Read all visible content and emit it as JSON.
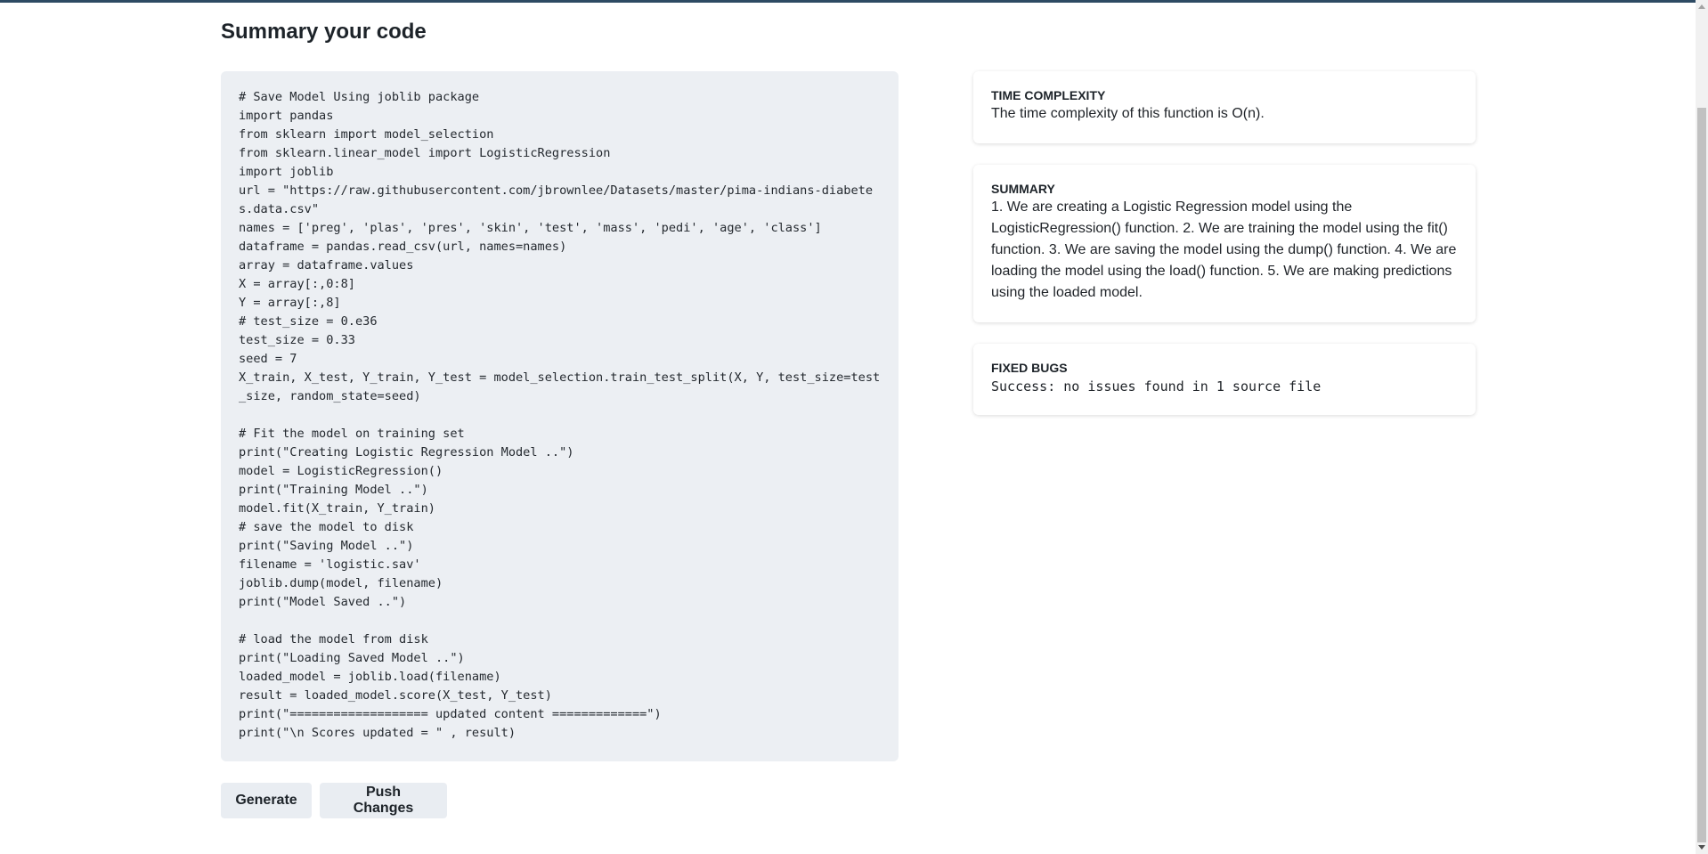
{
  "page": {
    "title": "Summary your code"
  },
  "code": {
    "content": "# Save Model Using joblib package\nimport pandas\nfrom sklearn import model_selection\nfrom sklearn.linear_model import LogisticRegression\nimport joblib\nurl = \"https://raw.githubusercontent.com/jbrownlee/Datasets/master/pima-indians-diabetes.data.csv\"\nnames = ['preg', 'plas', 'pres', 'skin', 'test', 'mass', 'pedi', 'age', 'class']\ndataframe = pandas.read_csv(url, names=names)\narray = dataframe.values\nX = array[:,0:8]\nY = array[:,8]\n# test_size = 0.e36\ntest_size = 0.33\nseed = 7\nX_train, X_test, Y_train, Y_test = model_selection.train_test_split(X, Y, test_size=test_size, random_state=seed)\n\n# Fit the model on training set\nprint(\"Creating Logistic Regression Model ..\")\nmodel = LogisticRegression()\nprint(\"Training Model ..\")\nmodel.fit(X_train, Y_train)\n# save the model to disk\nprint(\"Saving Model ..\")\nfilename = 'logistic.sav'\njoblib.dump(model, filename)\nprint(\"Model Saved ..\")\n\n# load the model from disk\nprint(\"Loading Saved Model ..\")\nloaded_model = joblib.load(filename)\nresult = loaded_model.score(X_test, Y_test)\nprint(\"=================== updated content =============\")\nprint(\"\\n Scores updated = \" , result)"
  },
  "buttons": {
    "generate": "Generate",
    "push_changes": "Push Changes"
  },
  "cards": {
    "time_complexity": {
      "label": "TIME COMPLEXITY",
      "text": "The time complexity of this function is O(n)."
    },
    "summary": {
      "label": "SUMMARY",
      "text": "1. We are creating a Logistic Regression model using the LogisticRegression() function. 2. We are training the model using the fit() function. 3. We are saving the model using the dump() function. 4. We are loading the model using the load() function. 5. We are making predictions using the loaded model."
    },
    "fixed_bugs": {
      "label": "FIXED BUGS",
      "text": "Success: no issues found in 1 source file"
    }
  },
  "colors": {
    "accent_bar": "#2d4a63",
    "code_background": "#eceff3",
    "button_background": "#e9edf2"
  }
}
